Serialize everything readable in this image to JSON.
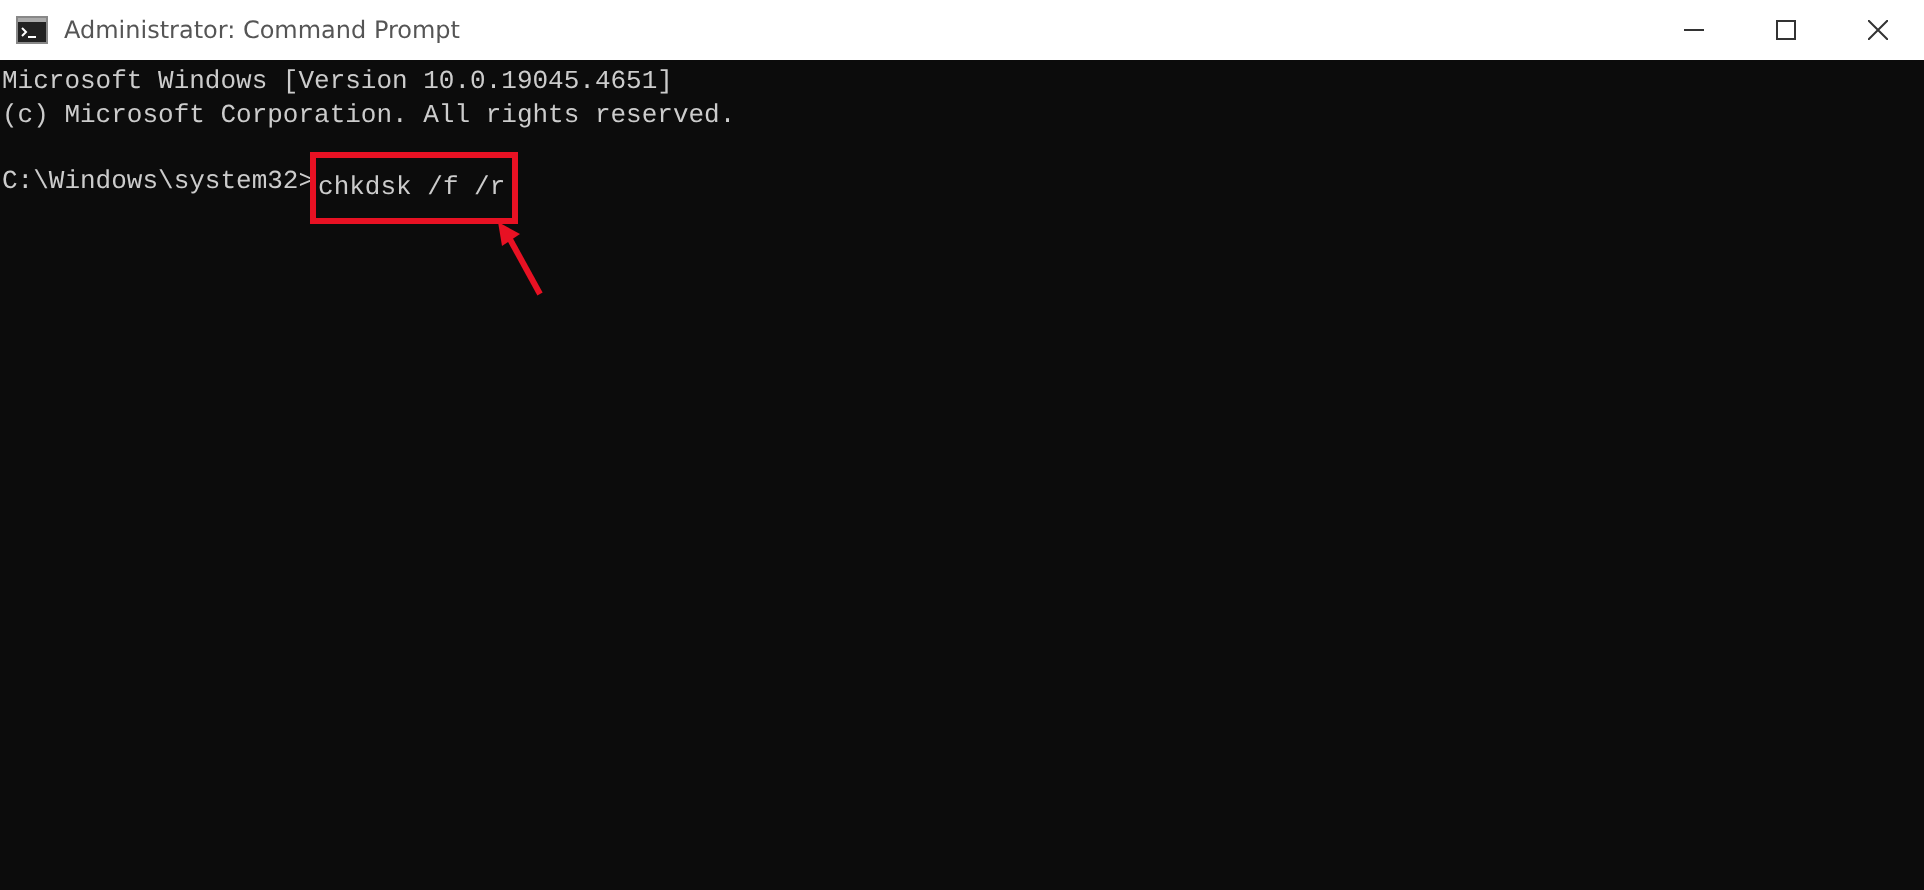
{
  "window": {
    "title": "Administrator: Command Prompt"
  },
  "console": {
    "lines": [
      "Microsoft Windows [Version 10.0.19045.4651]",
      "(c) Microsoft Corporation. All rights reserved."
    ],
    "prompt": "C:\\Windows\\system32>",
    "command": "chkdsk /f /r",
    "highlighted": true
  }
}
